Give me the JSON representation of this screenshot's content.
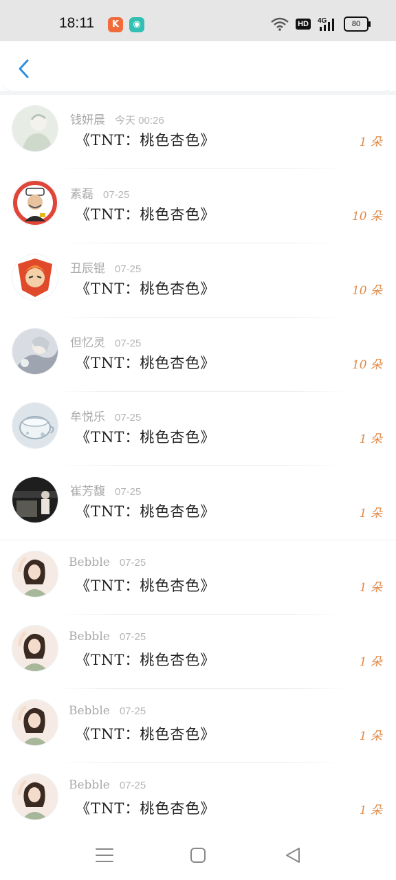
{
  "status_bar": {
    "time": "18:11",
    "badge_1": "K",
    "badge_2": "◉",
    "hd": "HD",
    "network": "4G",
    "battery": "80"
  },
  "header": {
    "back_icon": "chevron-left-icon",
    "accent": "#2d8fe0"
  },
  "colors": {
    "count": "#e08a4a",
    "name": "#a8a8a8"
  },
  "items": [
    {
      "name": "钱妍晨",
      "date": "今天 00:26",
      "title": "《TNT：桃色杏色》",
      "count": "1 朵"
    },
    {
      "name": "素磊",
      "date": "07-25",
      "title": "《TNT：桃色杏色》",
      "count": "10 朵"
    },
    {
      "name": "丑辰锟",
      "date": "07-25",
      "title": "《TNT：桃色杏色》",
      "count": "10 朵"
    },
    {
      "name": "但忆灵",
      "date": "07-25",
      "title": "《TNT：桃色杏色》",
      "count": "10 朵"
    },
    {
      "name": "牟悦乐",
      "date": "07-25",
      "title": "《TNT：桃色杏色》",
      "count": "1 朵"
    },
    {
      "name": "崔芳馥",
      "date": "07-25",
      "title": "《TNT：桃色杏色》",
      "count": "1 朵"
    },
    {
      "name": "Bebble",
      "date": "07-25",
      "title": "《TNT：桃色杏色》",
      "count": "1 朵"
    },
    {
      "name": "Bebble",
      "date": "07-25",
      "title": "《TNT：桃色杏色》",
      "count": "1 朵"
    },
    {
      "name": "Bebble",
      "date": "07-25",
      "title": "《TNT：桃色杏色》",
      "count": "1 朵"
    },
    {
      "name": "Bebble",
      "date": "07-25",
      "title": "《TNT：桃色杏色》",
      "count": "1 朵"
    }
  ],
  "nav": {
    "menu_icon": "menu-icon",
    "home_icon": "home-square-icon",
    "back_icon": "back-triangle-icon"
  }
}
